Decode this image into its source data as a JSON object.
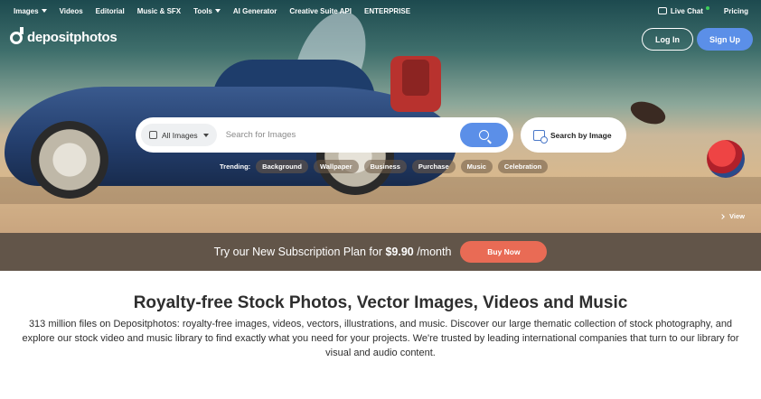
{
  "topnav": {
    "items": [
      {
        "label": "Images",
        "dropdown": true
      },
      {
        "label": "Videos",
        "dropdown": false
      },
      {
        "label": "Editorial",
        "dropdown": false
      },
      {
        "label": "Music & SFX",
        "dropdown": false
      },
      {
        "label": "Tools",
        "dropdown": true
      },
      {
        "label": "AI Generator",
        "dropdown": false
      },
      {
        "label": "Creative Suite API",
        "dropdown": false
      },
      {
        "label": "ENTERPRISE",
        "dropdown": false
      }
    ],
    "live_chat": "Live Chat",
    "pricing": "Pricing"
  },
  "header": {
    "logo_text": "depositphotos",
    "login_label": "Log In",
    "signup_label": "Sign Up"
  },
  "search": {
    "type_label": "All Images",
    "placeholder": "Search for Images",
    "by_image_label": "Search by Image"
  },
  "trending": {
    "label": "Trending:",
    "tags": [
      "Background",
      "Wallpaper",
      "Business",
      "Purchase",
      "Music",
      "Celebration"
    ]
  },
  "hero": {
    "view_label": "View"
  },
  "promo": {
    "text_before": "Try our New Subscription Plan for ",
    "price": "$9.90",
    "text_after": " /month",
    "button_label": "Buy Now"
  },
  "content": {
    "headline": "Royalty-free Stock Photos, Vector Images, Videos and Music",
    "description": "313 million files on Depositphotos: royalty-free images, videos, vectors, illustrations, and music. Discover our large thematic collection of stock photography, and explore our stock video and music library to find exactly what you need for your projects. We're trusted by leading international companies that turn to our library for visual and audio content."
  },
  "colors": {
    "accent_blue": "#5b8fe8",
    "buy_now": "#e96b55",
    "promo_bar": "#55463a",
    "online_dot": "#3ccf5a"
  }
}
